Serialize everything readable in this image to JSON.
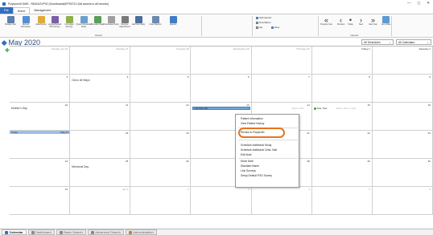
{
  "window": {
    "title": "Polysomnfr DMS - RDA012VP02 (Scoreboard)IEPS0712 (full access to all records)",
    "controls": [
      "—",
      "◻",
      "✕"
    ]
  },
  "ribbon_tabs": [
    {
      "label": "File",
      "kind": "file"
    },
    {
      "label": "Home",
      "kind": "active"
    },
    {
      "label": "Management",
      "kind": "normal"
    }
  ],
  "ribbon": {
    "buttons": [
      {
        "label": "Change User",
        "icon": "user-icon",
        "color": "#5b7fb0"
      },
      {
        "label": "Refresh Information",
        "icon": "refresh-icon",
        "color": "#4f8fd8"
      },
      {
        "label": "Attachments",
        "icon": "attachments-icon",
        "color": "#e2a93b"
      },
      {
        "label": "Lookup/Default PSG Survey",
        "icon": "survey-icon",
        "color": "#7b5ea8"
      },
      {
        "label": "Unmerged Surveys",
        "icon": "survey-edit-icon",
        "color": "#8fb04a"
      },
      {
        "label": "Unpost Scheduled Study",
        "icon": "unpost-icon",
        "color": "#6aa0d0"
      },
      {
        "label": "Schedule Study",
        "icon": "schedule-icon",
        "color": "#5a9e5a"
      },
      {
        "label": "Unschedule Study",
        "icon": "unschedule-icon",
        "color": "#a0a0a0"
      },
      {
        "label": "Remove Appointment",
        "icon": "remove-icon",
        "color": "#7a7a7a"
      },
      {
        "label": "Add New Study",
        "icon": "add-study-icon",
        "color": "#4a6fa0"
      },
      {
        "label": "Index Reports",
        "icon": "index-icon",
        "color": "#6a8ab0"
      },
      {
        "label": "Reports",
        "icon": "reports-icon",
        "color": "#3d7dc8"
      }
    ],
    "options": [
      "Staff Calendar",
      "Show Balloon",
      "Day",
      "Week"
    ],
    "nav_buttons": [
      {
        "label": "Previous Year",
        "glyph": "«"
      },
      {
        "label": "Previous",
        "glyph": "‹"
      },
      {
        "label": "Today",
        "glyph": "•"
      },
      {
        "label": "Next",
        "glyph": "›"
      },
      {
        "label": "Next Year",
        "glyph": "»"
      },
      {
        "label": "Go to Date",
        "glyph": ""
      }
    ],
    "groups": [
      "Refresh",
      "Calendar"
    ]
  },
  "calendar": {
    "month_title": "May 2020",
    "filter_schedules": "All Schedules",
    "filter_calendars": "All Calendars",
    "days": [
      {
        "num": "Sunday, Apr 26",
        "dim": true
      },
      {
        "num": "Monday 27",
        "dim": true
      },
      {
        "num": "Tuesday 28",
        "dim": true
      },
      {
        "num": "Wednesday 29",
        "dim": true
      },
      {
        "num": "Thursday 30",
        "dim": true
      },
      {
        "num": "Friday 1",
        "dim": false
      },
      {
        "num": "Saturday 2",
        "dim": false
      },
      {
        "num": "3",
        "dim": false
      },
      {
        "num": "4",
        "dim": false
      },
      {
        "num": "5",
        "dim": false
      },
      {
        "num": "6",
        "dim": false
      },
      {
        "num": "7",
        "dim": false
      },
      {
        "num": "8",
        "dim": false
      },
      {
        "num": "9",
        "dim": false
      },
      {
        "num": "10",
        "dim": false
      },
      {
        "num": "11",
        "dim": false
      },
      {
        "num": "12",
        "dim": false
      },
      {
        "num": "13",
        "dim": false
      },
      {
        "num": "14",
        "dim": false
      },
      {
        "num": "15",
        "dim": false
      },
      {
        "num": "16",
        "dim": false
      },
      {
        "num": "17",
        "dim": false
      },
      {
        "num": "18",
        "dim": false
      },
      {
        "num": "19",
        "dim": false
      },
      {
        "num": "20",
        "dim": false
      },
      {
        "num": "21",
        "dim": false
      },
      {
        "num": "22",
        "dim": false
      },
      {
        "num": "23",
        "dim": false
      },
      {
        "num": "24",
        "dim": false
      },
      {
        "num": "25",
        "dim": false
      },
      {
        "num": "26",
        "dim": false
      },
      {
        "num": "27",
        "dim": false
      },
      {
        "num": "28",
        "dim": false
      },
      {
        "num": "29",
        "dim": false
      },
      {
        "num": "30",
        "dim": false
      },
      {
        "num": "31",
        "dim": false
      },
      {
        "num": "Jun 1",
        "dim": true
      },
      {
        "num": "2",
        "dim": true
      },
      {
        "num": "3",
        "dim": true
      },
      {
        "num": "4",
        "dim": true
      },
      {
        "num": "5",
        "dim": true
      },
      {
        "num": "6",
        "dim": true
      }
    ],
    "events": {
      "cinco": "Cinco de Mayo",
      "mothers": "Mother's Day",
      "memorial": "Memorial Day",
      "today": "Today",
      "today_date": "May 17",
      "appt_13": "1:31 Test, Test",
      "appt_13b": "1 Test",
      "appt_15": "Test, Test",
      "faint_14": "Wed 1 Test",
      "faint_15": "Wed 1 Test, 1 Test"
    }
  },
  "context_menu": {
    "items": [
      "Patient Information",
      "View Patient History",
      "Review in Polysmith",
      "Schedule Additional Study",
      "Schedule Additional Clinic Visit",
      "Edit Note",
      "Move Note",
      "Standard Name",
      "Link Surveys",
      "Setup Default PSG Survey"
    ]
  },
  "bottom_tabs": [
    {
      "label": "Calendar",
      "icon": "calendar-icon",
      "color": "#2f6fc0",
      "active": true
    },
    {
      "label": "Dashboard",
      "icon": "dashboard-icon",
      "color": "#8a8a8a",
      "active": false
    },
    {
      "label": "Basic Search",
      "icon": "search-icon",
      "color": "#8a8a8a",
      "active": false
    },
    {
      "label": "Advanced Search",
      "icon": "advanced-search-icon",
      "color": "#8a8a8a",
      "active": false
    },
    {
      "label": "Administration",
      "icon": "admin-icon",
      "color": "#c8802a",
      "active": false
    }
  ],
  "colors": {
    "accent": "#2f6fc0",
    "highlight": "#e8731e",
    "today": "#9cc0e6"
  }
}
